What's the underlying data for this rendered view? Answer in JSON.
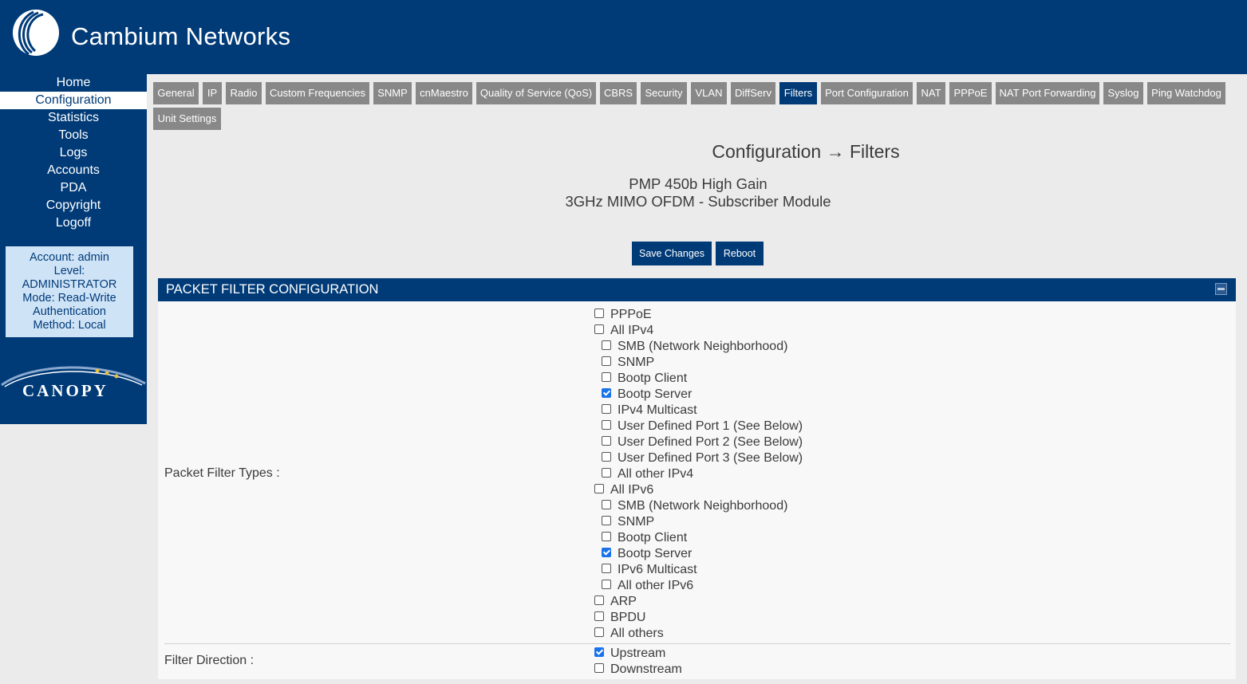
{
  "brand": {
    "name": "Cambium Networks",
    "secondary_logo": "CANOPY"
  },
  "sidebar": {
    "items": [
      {
        "label": "Home",
        "active": false
      },
      {
        "label": "Configuration",
        "active": true
      },
      {
        "label": "Statistics",
        "active": false
      },
      {
        "label": "Tools",
        "active": false
      },
      {
        "label": "Logs",
        "active": false
      },
      {
        "label": "Accounts",
        "active": false
      },
      {
        "label": "PDA",
        "active": false
      },
      {
        "label": "Copyright",
        "active": false
      },
      {
        "label": "Logoff",
        "active": false
      }
    ]
  },
  "account": {
    "lines": [
      "Account: admin",
      "Level:",
      "ADMINISTRATOR",
      "Mode: Read-Write",
      "Authentication",
      "Method: Local"
    ]
  },
  "tabs": [
    {
      "label": "General",
      "active": false
    },
    {
      "label": "IP",
      "active": false
    },
    {
      "label": "Radio",
      "active": false
    },
    {
      "label": "Custom Frequencies",
      "active": false
    },
    {
      "label": "SNMP",
      "active": false
    },
    {
      "label": "cnMaestro",
      "active": false
    },
    {
      "label": "Quality of Service (QoS)",
      "active": false
    },
    {
      "label": "CBRS",
      "active": false
    },
    {
      "label": "Security",
      "active": false
    },
    {
      "label": "VLAN",
      "active": false
    },
    {
      "label": "DiffServ",
      "active": false
    },
    {
      "label": "Filters",
      "active": true
    },
    {
      "label": "Port Configuration",
      "active": false
    },
    {
      "label": "NAT",
      "active": false
    },
    {
      "label": "PPPoE",
      "active": false
    },
    {
      "label": "NAT Port Forwarding",
      "active": false
    },
    {
      "label": "Syslog",
      "active": false
    },
    {
      "label": "Ping Watchdog",
      "active": false
    },
    {
      "label": "Unit Settings",
      "active": false
    }
  ],
  "page": {
    "title": "Configuration → Filters",
    "device_name": "PMP 450b High Gain",
    "device_type": "3GHz MIMO OFDM - Subscriber Module"
  },
  "buttons": {
    "save": "Save Changes",
    "reboot": "Reboot"
  },
  "panel": {
    "title": "PACKET FILTER CONFIGURATION",
    "filter_types_label": "Packet Filter Types :",
    "filter_direction_label": "Filter Direction :",
    "filter_types": [
      {
        "label": "PPPoE",
        "checked": false,
        "indent": 0
      },
      {
        "label": "All IPv4",
        "checked": false,
        "indent": 0
      },
      {
        "label": "SMB (Network Neighborhood)",
        "checked": false,
        "indent": 1
      },
      {
        "label": "SNMP",
        "checked": false,
        "indent": 1
      },
      {
        "label": "Bootp Client",
        "checked": false,
        "indent": 1
      },
      {
        "label": "Bootp Server",
        "checked": true,
        "indent": 1
      },
      {
        "label": "IPv4 Multicast",
        "checked": false,
        "indent": 1
      },
      {
        "label": "User Defined Port 1 (See Below)",
        "checked": false,
        "indent": 1
      },
      {
        "label": "User Defined Port 2 (See Below)",
        "checked": false,
        "indent": 1
      },
      {
        "label": "User Defined Port 3 (See Below)",
        "checked": false,
        "indent": 1
      },
      {
        "label": "All other IPv4",
        "checked": false,
        "indent": 1
      },
      {
        "label": "All IPv6",
        "checked": false,
        "indent": 0
      },
      {
        "label": "SMB (Network Neighborhood)",
        "checked": false,
        "indent": 1
      },
      {
        "label": "SNMP",
        "checked": false,
        "indent": 1
      },
      {
        "label": "Bootp Client",
        "checked": false,
        "indent": 1
      },
      {
        "label": "Bootp Server",
        "checked": true,
        "indent": 1
      },
      {
        "label": "IPv6 Multicast",
        "checked": false,
        "indent": 1
      },
      {
        "label": "All other IPv6",
        "checked": false,
        "indent": 1
      },
      {
        "label": "ARP",
        "checked": false,
        "indent": 0
      },
      {
        "label": "BPDU",
        "checked": false,
        "indent": 0
      },
      {
        "label": "All others",
        "checked": false,
        "indent": 0
      }
    ],
    "filter_direction": [
      {
        "label": "Upstream",
        "checked": true
      },
      {
        "label": "Downstream",
        "checked": false
      }
    ]
  }
}
